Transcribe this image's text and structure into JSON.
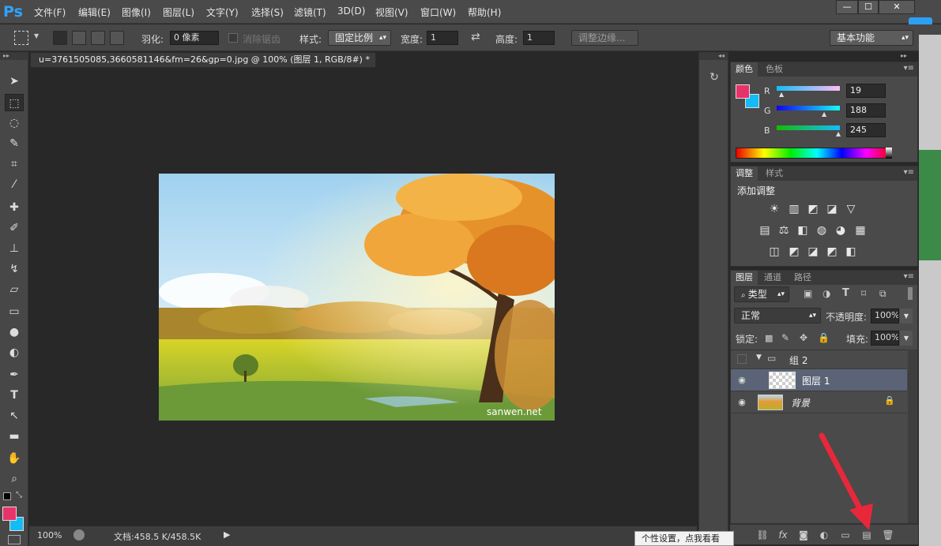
{
  "app": {
    "logo": "Ps"
  },
  "menu": [
    "文件(F)",
    "编辑(E)",
    "图像(I)",
    "图层(L)",
    "文字(Y)",
    "选择(S)",
    "滤镜(T)",
    "3D(D)",
    "视图(V)",
    "窗口(W)",
    "帮助(H)"
  ],
  "window_controls": {
    "minimize": "—",
    "restore": "☐",
    "close": "✕"
  },
  "options": {
    "feather_label": "羽化:",
    "feather_value": "0 像素",
    "antialias_label": "消除锯齿",
    "style_label": "样式:",
    "style_value": "固定比例",
    "width_label": "宽度:",
    "width_value": "1",
    "height_label": "高度:",
    "height_value": "1",
    "refine_edge": "调整边缘...",
    "workspace": "基本功能"
  },
  "document": {
    "tab_title": "u=3761505085,3660581146&fm=26&gp=0.jpg @ 100% (图层 1, RGB/8#) *",
    "tab_close": "×",
    "watermark": "sanwen.net"
  },
  "status": {
    "zoom": "100%",
    "doc_info": "文档:458.5 K/458.5K"
  },
  "color_panel": {
    "tabs": [
      "颜色",
      "色板"
    ],
    "r_label": "R",
    "r_value": "19",
    "g_label": "G",
    "g_value": "188",
    "b_label": "B",
    "b_value": "245",
    "fg_color": "#e8336a",
    "bg_color": "#13bcf5"
  },
  "adjust_panel": {
    "tabs": [
      "调整",
      "样式"
    ],
    "title": "添加调整",
    "row1": [
      "☀",
      "▥",
      "◩",
      "◪",
      "▽"
    ],
    "row2": [
      "▤",
      "⚖",
      "◧",
      "◍",
      "◕",
      "▦"
    ],
    "row3": [
      "◫",
      "◩",
      "◪",
      "◩",
      "◧"
    ]
  },
  "layers_panel": {
    "tabs": [
      "图层",
      "通道",
      "路径"
    ],
    "filter_kind": "类型",
    "blend_mode": "正常",
    "opacity_label": "不透明度:",
    "opacity_value": "100%",
    "lock_label": "锁定:",
    "fill_label": "填充:",
    "fill_value": "100%",
    "layers": [
      {
        "name": "组 2",
        "type": "group"
      },
      {
        "name": "图层 1",
        "type": "layer",
        "selected": true
      },
      {
        "name": "背景",
        "type": "background",
        "locked": true
      }
    ]
  },
  "tooltip": "个性设置，点我看看"
}
